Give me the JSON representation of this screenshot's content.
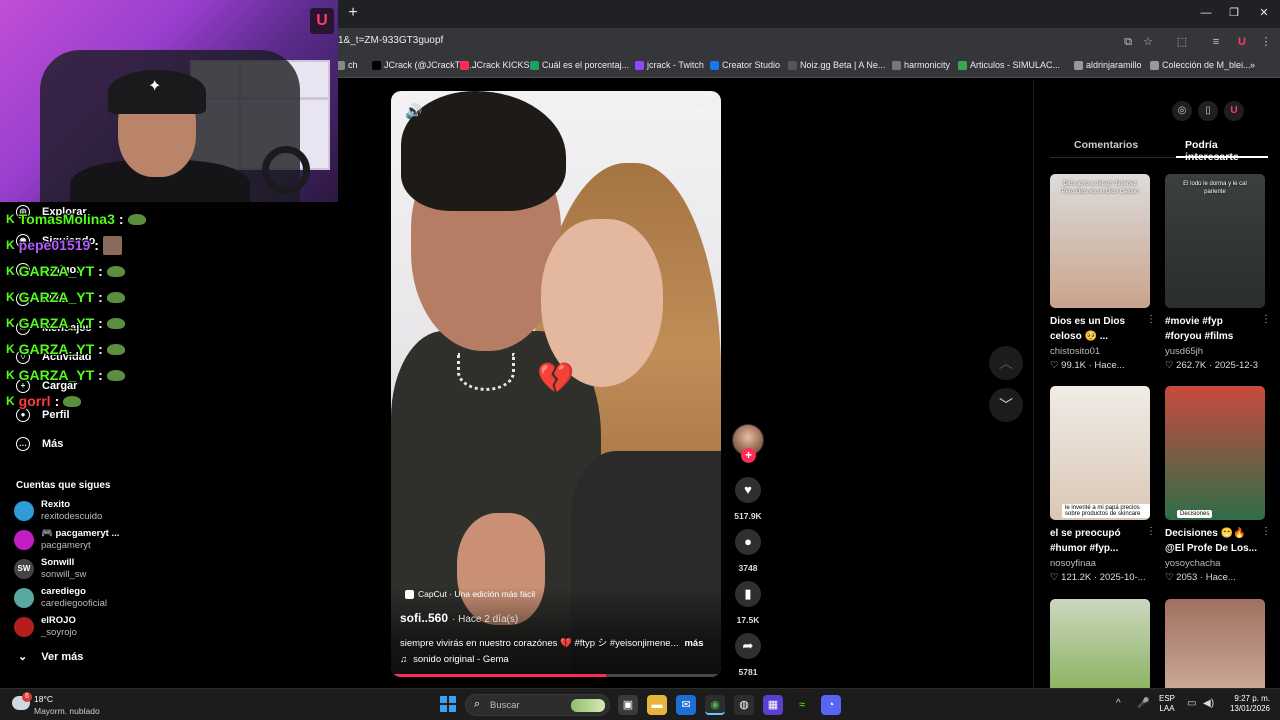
{
  "browser": {
    "url": "1&_t=ZM-933GT3guopf",
    "new_tab": "+",
    "bookmarks": [
      {
        "label": "ch",
        "color": "#888"
      },
      {
        "label": "JCrack (@JCrackTV)...",
        "color": "#000"
      },
      {
        "label": "JCrack KICKS",
        "color": "#fe2c55"
      },
      {
        "label": "Cuál es el porcentaj...",
        "color": "#1aa260"
      },
      {
        "label": "jcrack - Twitch",
        "color": "#9146ff"
      },
      {
        "label": "Creator Studio",
        "color": "#1877f2"
      },
      {
        "label": "Noiz.gg Beta | A Ne...",
        "color": "#555"
      },
      {
        "label": "harmonicity",
        "color": "#777"
      },
      {
        "label": "Articulos - SIMULAC...",
        "color": "#34a853"
      },
      {
        "label": "aldrinjaramillo",
        "color": "#999"
      },
      {
        "label": "Colección de M_blei...",
        "color": "#999"
      }
    ]
  },
  "sidebar": {
    "nav": [
      {
        "label": "Explorar",
        "icon": "compass-icon"
      },
      {
        "label": "Siguiendo",
        "icon": "following-icon"
      },
      {
        "label": "Amigos",
        "icon": "friends-icon"
      },
      {
        "label": "LIVE",
        "icon": "live-icon"
      },
      {
        "label": "Mensajes",
        "icon": "messages-icon"
      },
      {
        "label": "Actividad",
        "icon": "activity-icon"
      },
      {
        "label": "Cargar",
        "icon": "upload-icon"
      },
      {
        "label": "Perfil",
        "icon": "profile-icon"
      },
      {
        "label": "Más",
        "icon": "more-icon"
      }
    ],
    "following_title": "Cuentas que sigues",
    "accounts": [
      {
        "name": "Rexito",
        "handle": "rexitodescuido",
        "color": "#2f9bd8",
        "initials": ""
      },
      {
        "name": "🎮 pacgameryt ...",
        "handle": "pacgameryt",
        "color": "#c21ec4",
        "initials": ""
      },
      {
        "name": "Sonwill",
        "handle": "sonwill_sw",
        "color": "#444",
        "initials": "SW"
      },
      {
        "name": "carediego",
        "handle": "carediegooficial",
        "color": "#5aa9a0",
        "initials": ""
      },
      {
        "name": "elROJO",
        "handle": "_soyrojo",
        "color": "#b31f1f",
        "initials": ""
      }
    ],
    "see_more": "Ver más"
  },
  "chat": [
    {
      "user": "TomasMolina3",
      "color": "#53fc18",
      "emote": "pepe"
    },
    {
      "user": "pepe01519",
      "color": "#b25bff",
      "emote": "img"
    },
    {
      "user": "GARZA_YT",
      "color": "#53fc18",
      "emote": "pepe"
    },
    {
      "user": "GARZA_YT",
      "color": "#53fc18",
      "emote": "pepe"
    },
    {
      "user": "GARZA_YT",
      "color": "#53fc18",
      "emote": "pepe"
    },
    {
      "user": "GARZA_YT",
      "color": "#53fc18",
      "emote": "pepe"
    },
    {
      "user": "GARZA_YT",
      "color": "#53fc18",
      "emote": "pepe"
    },
    {
      "user": "gorrl",
      "color": "#ff3b3b",
      "emote": "pepe"
    }
  ],
  "video": {
    "watermark": "CapCut · Una edición más fácil",
    "author": "sofi..560",
    "time": "· Hace 2 día(s)",
    "caption": "siempre vivirás en nuestro corazónes 💔 #ftyp シ #yeisonjimene...",
    "caption_more": "más",
    "sound": "sonido original - Gema",
    "progress": 0.65
  },
  "actions": {
    "likes": "517.9K",
    "comments": "3748",
    "saves": "17.5K",
    "shares": "5781"
  },
  "panel": {
    "tabs": [
      "Comentarios",
      "Podría interesarte"
    ],
    "active_tab": 1,
    "cards": [
      {
        "title": "Dios es un Dios celoso 🥺 ...",
        "user": "chistosito01",
        "stats": "♡ 99.1K · Hace...",
        "thumb_text": "Dios amo a Jeison Jiménez Pero Dios es un Dios Celoso",
        "thumb_label": "",
        "bg": "linear-gradient(180deg,#dcdcdc,#c9a38c)"
      },
      {
        "title": "#movie #fyp #foryou #films",
        "user": "yusd65jh",
        "stats": "♡ 262.7K · 2025-12-3",
        "thumb_text": "El lodo le dorma y le cal pariente",
        "thumb_label": "",
        "bg": "linear-gradient(180deg,#3b3f3e,#2a2f2b)"
      },
      {
        "title": "el se preocupó #humor #fyp...",
        "user": "nosoyfinaa",
        "stats": "♡ 121.2K · 2025-10-...",
        "thumb_text": "",
        "thumb_label": "le inventé a mi papá precios sobre productos de skincare",
        "bg": "linear-gradient(180deg,#f1ece6,#d9c7b5)"
      },
      {
        "title": "Decisiones 😁🔥 @El Profe De Los...",
        "user": "yosoychacha",
        "stats": "♡ 2053 · Hace...",
        "thumb_text": "",
        "thumb_label": "Decisiones",
        "bg": "linear-gradient(180deg,#c94a3e,#2e6e48)"
      },
      {
        "title": "",
        "user": "",
        "stats": "",
        "thumb_text": "",
        "thumb_label": "",
        "bg": "linear-gradient(180deg,#cbd7c0,#6fa234)"
      },
      {
        "title": "",
        "user": "",
        "stats": "",
        "thumb_text": "",
        "thumb_label": "",
        "bg": "linear-gradient(180deg,#a07060,#e0c2b0)"
      }
    ]
  },
  "taskbar": {
    "weather_temp": "18°C",
    "weather_desc": "Mayorm. nublado",
    "weather_badge": "6",
    "search": "Buscar",
    "lang": [
      "ESP",
      "LAA"
    ],
    "time": "9:27 p. m.",
    "date": "13/01/2026"
  }
}
